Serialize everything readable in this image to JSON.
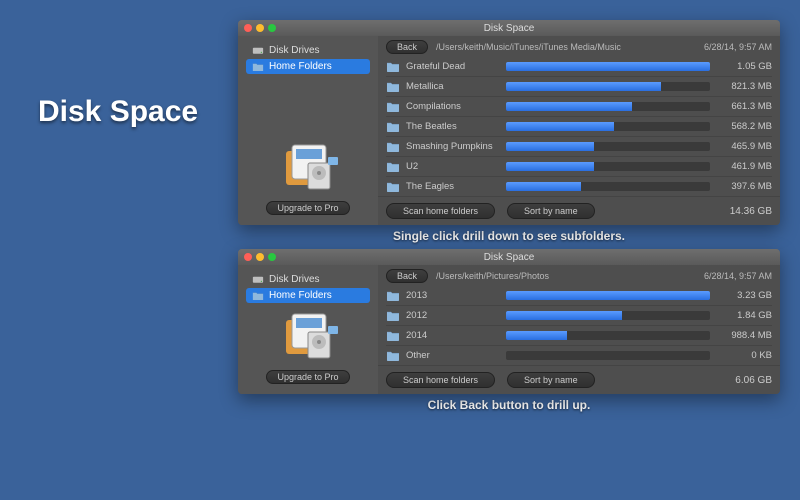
{
  "hero_title": "Disk Space",
  "caption1": "Single click drill down to see subfolders.",
  "caption2": "Click Back button to drill up.",
  "window_title": "Disk Space",
  "timestamp": "6/28/14, 9:57 AM",
  "sidebar": {
    "items": [
      {
        "label": "Disk Drives",
        "icon": "drive-icon",
        "active": false
      },
      {
        "label": "Home Folders",
        "icon": "folder-icon",
        "active": true
      }
    ],
    "upgrade_label": "Upgrade to Pro"
  },
  "buttons": {
    "back": "Back",
    "scan": "Scan home folders",
    "sort": "Sort by name"
  },
  "win1": {
    "path": "/Users/keith/Music/iTunes/iTunes Media/Music",
    "total": "14.36 GB",
    "max_bytes": 1127428915,
    "rows": [
      {
        "name": "Grateful Dead",
        "size": "1.05 GB",
        "pct": 100
      },
      {
        "name": "Metallica",
        "size": "821.3 MB",
        "pct": 76
      },
      {
        "name": "Compilations",
        "size": "661.3 MB",
        "pct": 62
      },
      {
        "name": "The Beatles",
        "size": "568.2 MB",
        "pct": 53
      },
      {
        "name": "Smashing Pumpkins",
        "size": "465.9 MB",
        "pct": 43
      },
      {
        "name": "U2",
        "size": "461.9 MB",
        "pct": 43
      },
      {
        "name": "The Eagles",
        "size": "397.6 MB",
        "pct": 37
      }
    ]
  },
  "win2": {
    "path": "/Users/keith/Pictures/Photos",
    "total": "6.06 GB",
    "max_bytes": 3468309299,
    "rows": [
      {
        "name": "2013",
        "size": "3.23 GB",
        "pct": 100
      },
      {
        "name": "2012",
        "size": "1.84 GB",
        "pct": 57
      },
      {
        "name": "2014",
        "size": "988.4 MB",
        "pct": 30
      },
      {
        "name": "Other",
        "size": "0 KB",
        "pct": 0
      }
    ]
  }
}
